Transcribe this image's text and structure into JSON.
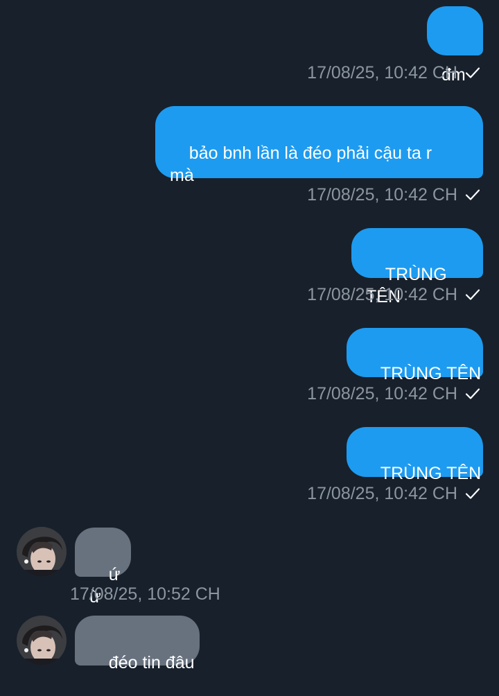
{
  "theme": {
    "background": "#18202b",
    "outgoing_bubble": "#1d9bf0",
    "incoming_bubble": "#68727f",
    "timestamp_color": "#8b96a1",
    "text_color": "#ffffff"
  },
  "messages": [
    {
      "direction": "outgoing",
      "text": "đm",
      "timestamp": "17/08/25, 10:42 CH",
      "status_icon": "checkmark-icon"
    },
    {
      "direction": "outgoing",
      "text": "bảo bnh lần là đéo phải cậu ta r\nmà",
      "timestamp": "17/08/25, 10:42 CH",
      "status_icon": "checkmark-icon"
    },
    {
      "direction": "outgoing",
      "text": "TRÙNG TÊN",
      "timestamp": "17/08/25, 10:42 CH",
      "status_icon": "checkmark-icon"
    },
    {
      "direction": "outgoing",
      "text": "TRÙNG TÊN",
      "timestamp": "17/08/25, 10:42 CH",
      "status_icon": "checkmark-icon"
    },
    {
      "direction": "outgoing",
      "text": "TRÙNG TÊN",
      "timestamp": "17/08/25, 10:42 CH",
      "status_icon": "checkmark-icon"
    },
    {
      "direction": "incoming",
      "text": "ứ ừ",
      "timestamp": "17/08/25, 10:52 CH",
      "avatar": "user-avatar"
    },
    {
      "direction": "incoming",
      "text": "đéo tin đâu",
      "avatar": "user-avatar"
    }
  ]
}
